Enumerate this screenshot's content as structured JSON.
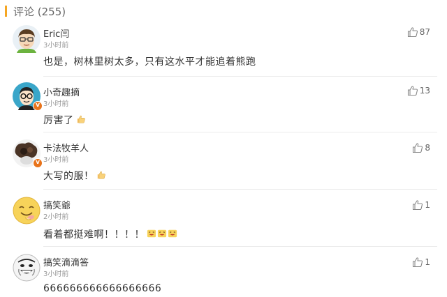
{
  "header": {
    "title": "评论 (255)"
  },
  "comments": [
    {
      "user": "Eric闫",
      "time": "3小时前",
      "text": "也是，树林里树太多，只有这水平才能追着熊跑",
      "likes": "87",
      "verified": false
    },
    {
      "user": "小奇趣摘",
      "time": "3小时前",
      "text": "厉害了",
      "likes": "13",
      "verified": true
    },
    {
      "user": "卡法牧羊人",
      "time": "3小时前",
      "text": "大写的服！",
      "likes": "8",
      "verified": true
    },
    {
      "user": "搞笑爺",
      "time": "2小时前",
      "text": "看着都挺难啊！！！！",
      "likes": "1",
      "verified": false
    },
    {
      "user": "搞笑滴滴答",
      "time": "3小时前",
      "text": "666666666666666666",
      "likes": "1",
      "verified": false
    }
  ],
  "colors": {
    "accent": "#f5a623",
    "verified_badge": "#e8731a"
  },
  "icons": {
    "like": "thumbs-up-icon",
    "inline_emoji": "thumbs-up-emoji",
    "laugh_emoji": "laughing-face-emoji"
  }
}
